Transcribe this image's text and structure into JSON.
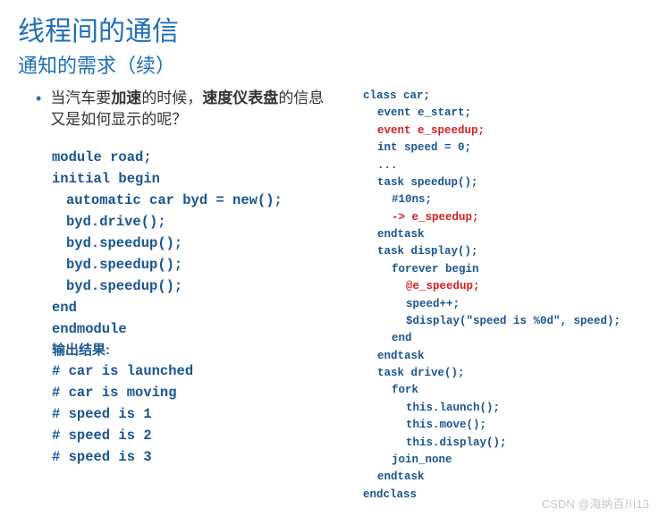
{
  "title": "线程间的通信",
  "subtitle": "通知的需求（续）",
  "bullet": {
    "pre": "当汽车要",
    "bold1": "加速",
    "mid": "的时候，",
    "bold2": "速度仪表盘",
    "post": "的信息又是如何显示的呢？"
  },
  "left_code": {
    "l1": "module road;",
    "l2": "initial begin",
    "l3": "automatic car byd = new();",
    "l4": "byd.drive();",
    "l5": "byd.speedup();",
    "l6": "byd.speedup();",
    "l7": "byd.speedup();",
    "l8": "end",
    "l9": "endmodule",
    "label": "输出结果:",
    "o1": "# car is launched",
    "o2": "# car is moving",
    "o3": "# speed is 1",
    "o4": "# speed is 2",
    "o5": "# speed is 3"
  },
  "right_code": {
    "r1": "class car;",
    "r2": "event e_start;",
    "r3": "event e_speedup;",
    "r4": "int speed = 0;",
    "r5": "...",
    "r6": "task speedup();",
    "r7": "#10ns;",
    "r8": "-> e_speedup;",
    "r9": "endtask",
    "r10": "task display();",
    "r11": "forever begin",
    "r12": "@e_speedup;",
    "r13": "speed++;",
    "r14": "$display(\"speed is %0d\", speed);",
    "r15": "end",
    "r16": "endtask",
    "r17": "task drive();",
    "r18": "fork",
    "r19": "this.launch();",
    "r20": "this.move();",
    "r21": "this.display();",
    "r22": "join_none",
    "r23": "endtask",
    "r24": "endclass"
  },
  "watermark": "CSDN @海纳百川13"
}
